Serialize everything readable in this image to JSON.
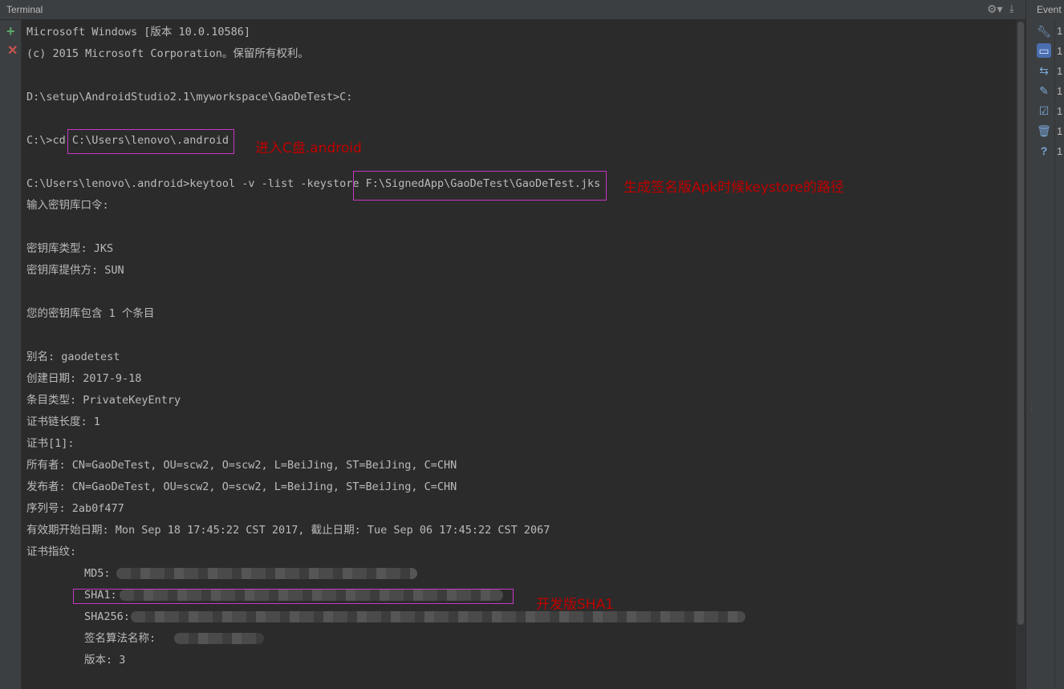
{
  "titlebar": {
    "title": "Terminal"
  },
  "terminal": {
    "lines": [
      "Microsoft Windows [版本 10.0.10586]",
      "(c) 2015 Microsoft Corporation。保留所有权利。",
      "",
      "D:\\setup\\AndroidStudio2.1\\myworkspace\\GaoDeTest>C:",
      "",
      "C:\\>cd C:\\Users\\lenovo\\.android",
      "",
      "C:\\Users\\lenovo\\.android>keytool -v -list -keystore F:\\SignedApp\\GaoDeTest\\GaoDeTest.jks",
      "输入密钥库口令:",
      "",
      "密钥库类型: JKS",
      "密钥库提供方: SUN",
      "",
      "您的密钥库包含 1 个条目",
      "",
      "别名: gaodetest",
      "创建日期: 2017-9-18",
      "条目类型: PrivateKeyEntry",
      "证书链长度: 1",
      "证书[1]:",
      "所有者: CN=GaoDeTest, OU=scw2, O=scw2, L=BeiJing, ST=BeiJing, C=CHN",
      "发布者: CN=GaoDeTest, OU=scw2, O=scw2, L=BeiJing, ST=BeiJing, C=CHN",
      "序列号: 2ab0f477",
      "有效期开始日期: Mon Sep 18 17:45:22 CST 2017, 截止日期: Tue Sep 06 17:45:22 CST 2067",
      "证书指纹:"
    ],
    "fingerprints": {
      "md5_label": "MD5:",
      "sha1_label": "SHA1:",
      "sha256_label": "SHA256:",
      "sig_label": "签名算法名称:",
      "version_line": "版本: 3"
    },
    "annotations": {
      "cd_note": "进入C盘.android",
      "keystore_note": "生成签名版Apk时候keystore的路径",
      "sha1_note": "开发版SHA1"
    }
  },
  "event_log": {
    "title": "Event Log",
    "items": [
      {
        "icon": "wrench-icon",
        "num": "1"
      },
      {
        "icon": "message-icon",
        "num": "1"
      },
      {
        "icon": "wrap-icon",
        "num": "1"
      },
      {
        "icon": "edit-icon",
        "num": "1"
      },
      {
        "icon": "check-icon",
        "num": "1"
      },
      {
        "icon": "trash-icon",
        "num": "1"
      },
      {
        "icon": "help-icon",
        "num": "1"
      }
    ]
  },
  "colors": {
    "background": "#2b2b2b",
    "text": "#bbbbbb",
    "highlight_box": "#c736c7",
    "annotation": "#c00000"
  }
}
